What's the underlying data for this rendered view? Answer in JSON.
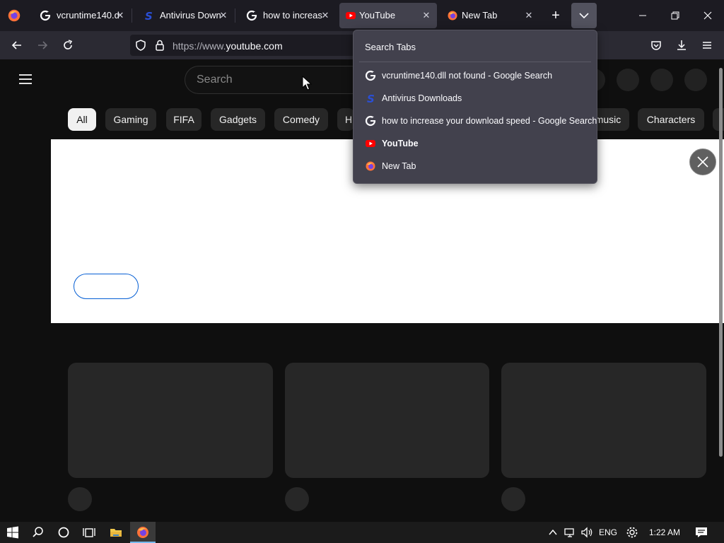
{
  "browser": {
    "tabs": [
      {
        "title": "vcruntime140.dll",
        "favicon": "google-g-icon"
      },
      {
        "title": "Antivirus Downlo",
        "favicon": "antivirus-s-icon"
      },
      {
        "title": "how to increase",
        "favicon": "google-g-icon"
      },
      {
        "title": "YouTube",
        "favicon": "youtube-icon",
        "active": true
      },
      {
        "title": "New Tab",
        "favicon": "firefox-icon"
      }
    ],
    "url_host": "https://www.",
    "url_domain": "youtube.com"
  },
  "all_tabs_panel": {
    "title": "Search Tabs",
    "items": [
      {
        "label": "vcruntime140.dll not found - Google Search",
        "favicon": "google-g-icon"
      },
      {
        "label": "Antivirus Downloads",
        "favicon": "antivirus-s-icon"
      },
      {
        "label": "how to increase your download speed - Google Search",
        "favicon": "google-g-icon"
      },
      {
        "label": "YouTube",
        "favicon": "youtube-icon",
        "current": true
      },
      {
        "label": "New Tab",
        "favicon": "firefox-icon"
      }
    ]
  },
  "youtube": {
    "search_placeholder": "Search",
    "chips": [
      "All",
      "Gaming",
      "FIFA",
      "Gadgets",
      "Comedy",
      "H",
      "music",
      "Characters"
    ],
    "selected_chip": "All"
  },
  "taskbar": {
    "language": "ENG",
    "time": "1:22 AM"
  },
  "colors": {
    "accent_blue": "#065fd4",
    "youtube_red": "#ff0000",
    "chrome_dark": "#1c1b22"
  }
}
